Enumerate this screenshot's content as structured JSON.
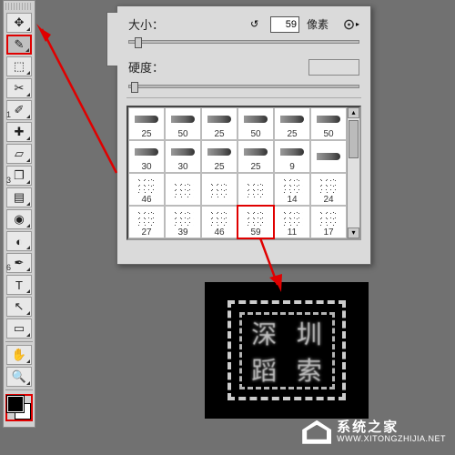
{
  "toolbox": {
    "tools": [
      {
        "name": "move",
        "n": null
      },
      {
        "name": "brush",
        "n": null,
        "selected": true,
        "highlight": true
      },
      {
        "name": "marquee",
        "n": null
      },
      {
        "name": "crop",
        "n": null
      },
      {
        "name": "eyedropper",
        "n": "1"
      },
      {
        "name": "healing",
        "n": null
      },
      {
        "name": "eraser",
        "n": null
      },
      {
        "name": "clone",
        "n": "3"
      },
      {
        "name": "gradient",
        "n": null
      },
      {
        "name": "blur",
        "n": null
      },
      {
        "name": "dodge",
        "n": null
      },
      {
        "name": "pen",
        "n": "6"
      },
      {
        "name": "type",
        "n": null
      },
      {
        "name": "path",
        "n": null
      },
      {
        "name": "shape",
        "n": null
      },
      {
        "name": "hand",
        "n": null
      },
      {
        "name": "zoom",
        "n": null
      }
    ]
  },
  "brush_panel": {
    "size_label": "大小：",
    "size_value": "59",
    "size_unit": "像素",
    "hardness_label": "硬度：",
    "brushes": [
      {
        "v": "25",
        "t": "bullet"
      },
      {
        "v": "50",
        "t": "bullet"
      },
      {
        "v": "25",
        "t": "bullet"
      },
      {
        "v": "50",
        "t": "bullet"
      },
      {
        "v": "25",
        "t": "bullet"
      },
      {
        "v": "50",
        "t": "bullet"
      },
      {
        "v": "30",
        "t": "bullet"
      },
      {
        "v": "30",
        "t": "bullet"
      },
      {
        "v": "25",
        "t": "bullet"
      },
      {
        "v": "25",
        "t": "bullet"
      },
      {
        "v": "9",
        "t": "bullet"
      },
      {
        "v": "",
        "t": "bullet"
      },
      {
        "v": "46",
        "t": "spatter"
      },
      {
        "v": "",
        "t": "spatter"
      },
      {
        "v": "",
        "t": "spatter"
      },
      {
        "v": "",
        "t": "spatter"
      },
      {
        "v": "14",
        "t": "spatter"
      },
      {
        "v": "24",
        "t": "spatter"
      },
      {
        "v": "27",
        "t": "spatter"
      },
      {
        "v": "39",
        "t": "spatter"
      },
      {
        "v": "46",
        "t": "spatter"
      },
      {
        "v": "59",
        "t": "spatter",
        "sel": true
      },
      {
        "v": "11",
        "t": "spatter"
      },
      {
        "v": "17",
        "t": "spatter"
      }
    ]
  },
  "preview": {
    "chars": [
      "深",
      "圳",
      "蹈",
      "索"
    ]
  },
  "watermark": {
    "cn": "系统之家",
    "url": "WWW.XITONGZHIJIA.NET"
  }
}
